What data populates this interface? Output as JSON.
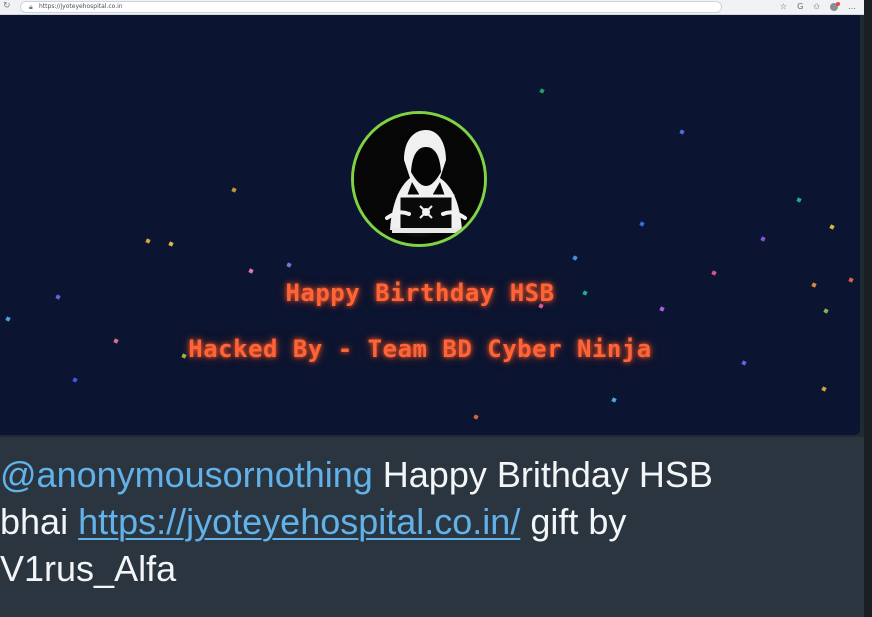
{
  "browser": {
    "url": "https://jyoteyehospital.co.in"
  },
  "hero": {
    "line1": "Happy Birthday HSB",
    "line2": "Hacked By - Team BD Cyber Ninja"
  },
  "tweet": {
    "mention": "@anonymousornothing",
    "text_a": " Happy Brithday HSB",
    "text_b": "bhai ",
    "link": "https://jyoteyehospital.co.in/",
    "text_c": "  gift by",
    "text_d": "V1rus_Alfa"
  },
  "colors": {
    "hero_background": "#0b1430",
    "hacked_text": "#ff6436",
    "logo_ring": "#7fd343",
    "link": "#62b2ea",
    "caption_background": "#2b3540"
  },
  "icons": {
    "reload": "reload-icon",
    "lock": "lock-icon",
    "star": "star-icon",
    "extension": "extension-icon",
    "bookmark": "bookmark-icon",
    "profile": "profile-avatar",
    "menu": "more-icon"
  }
}
